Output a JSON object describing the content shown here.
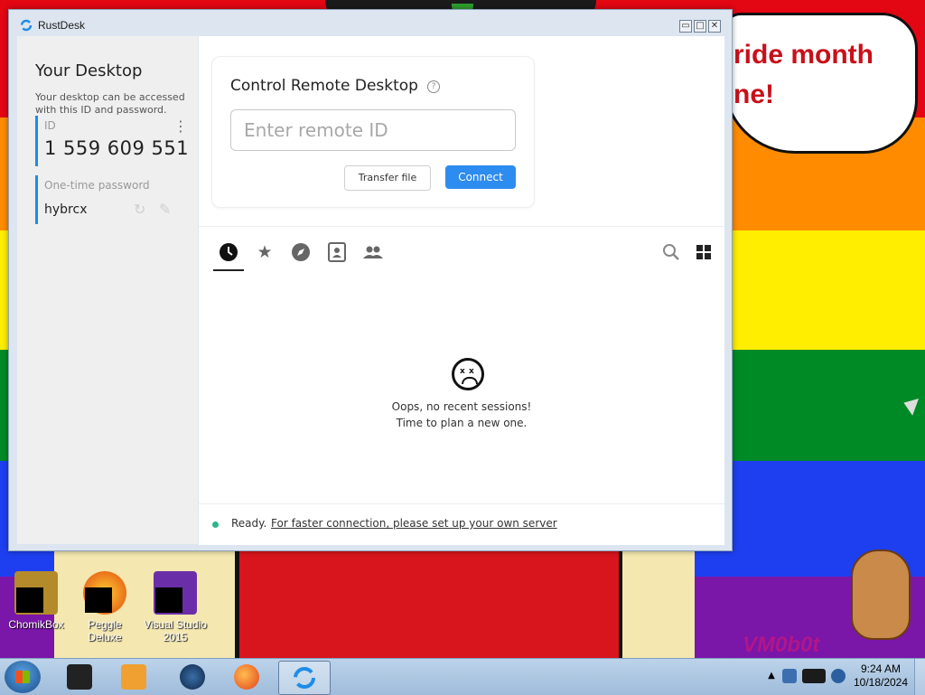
{
  "wallpaper": {
    "speech_line1": "ride month",
    "speech_line2": "ne!",
    "vm_logo": "VM0b0t"
  },
  "desktop_icons": [
    {
      "label": "ChomikBox"
    },
    {
      "label": "Peggle Deluxe"
    },
    {
      "label": "Visual Studio 2015"
    }
  ],
  "window": {
    "title": "RustDesk",
    "icon": "rustdesk-logo-icon",
    "controls": {
      "minimize": "minimize-icon",
      "maximize": "maximize-icon",
      "close": "close-icon"
    }
  },
  "left_panel": {
    "title": "Your Desktop",
    "description": "Your desktop can be accessed with this ID and password.",
    "id_label": "ID",
    "id_value": "1 559 609 551",
    "password_label": "One-time password",
    "password_value": "hybrcx"
  },
  "control": {
    "title": "Control Remote Desktop",
    "input_placeholder": "Enter remote ID",
    "input_value": "",
    "transfer_label": "Transfer file",
    "connect_label": "Connect"
  },
  "tabs": [
    {
      "name": "recent",
      "icon": "clock-icon",
      "active": true
    },
    {
      "name": "favorites",
      "icon": "star-icon",
      "active": false
    },
    {
      "name": "discovered",
      "icon": "compass-icon",
      "active": false
    },
    {
      "name": "address-book",
      "icon": "contact-card-icon",
      "active": false
    },
    {
      "name": "group",
      "icon": "people-icon",
      "active": false
    }
  ],
  "empty_state": {
    "line1": "Oops, no recent sessions!",
    "line2": "Time to plan a new one."
  },
  "status": {
    "ready": "Ready.",
    "link": "For faster connection, please set up your own server"
  },
  "taskbar": {
    "time": "9:24 AM",
    "date": "10/18/2024",
    "accent": "#2d8cf0"
  }
}
